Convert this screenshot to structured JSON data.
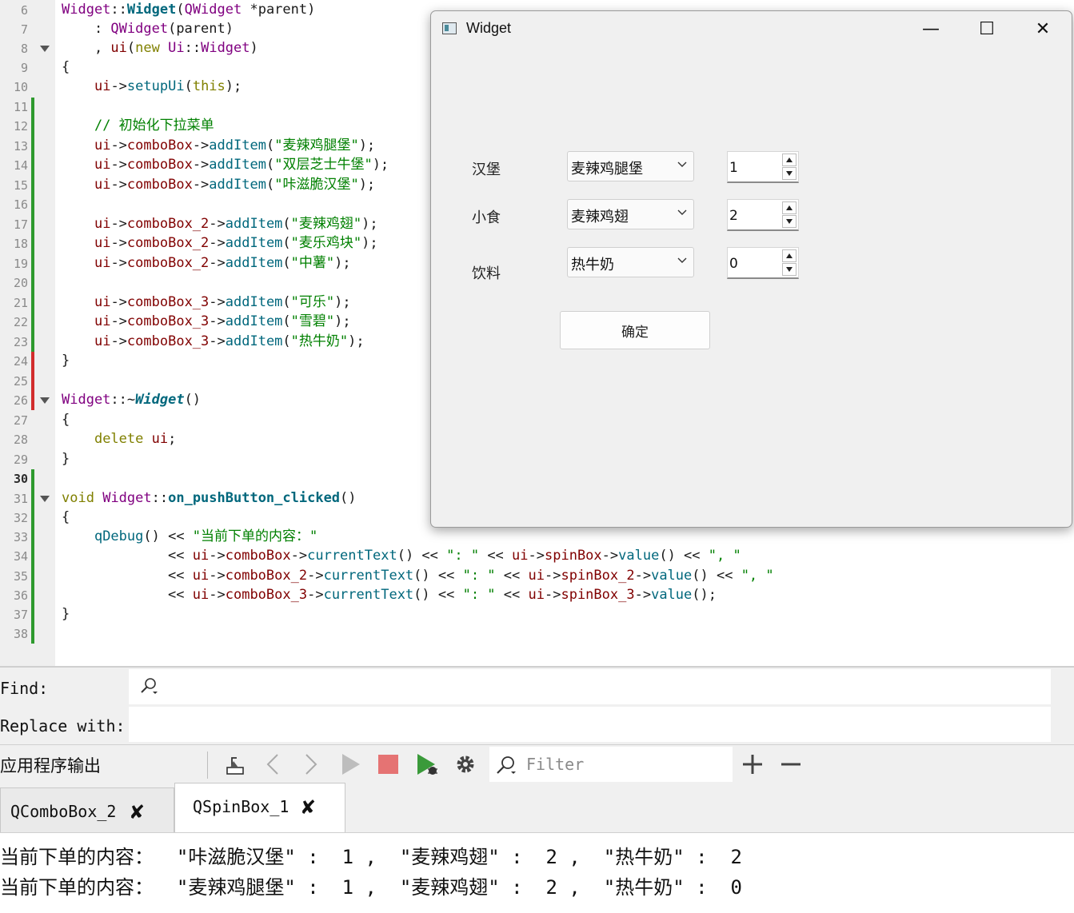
{
  "editor": {
    "line_numbers": [
      "6",
      "7",
      "8",
      "9",
      "10",
      "11",
      "12",
      "13",
      "14",
      "15",
      "16",
      "17",
      "18",
      "19",
      "20",
      "21",
      "22",
      "23",
      "24",
      "25",
      "26",
      "27",
      "28",
      "29",
      "30",
      "31",
      "32",
      "33",
      "34",
      "35",
      "36",
      "37",
      "38"
    ],
    "lines": [
      "Widget::Widget(QWidget *parent)",
      "    : QWidget(parent)",
      "    , ui(new Ui::Widget)",
      "{",
      "    ui->setupUi(this);",
      "",
      "    // 初始化下拉菜单",
      "    ui->comboBox->addItem(\"麦辣鸡腿堡\");",
      "    ui->comboBox->addItem(\"双层芝士牛堡\");",
      "    ui->comboBox->addItem(\"咔滋脆汉堡\");",
      "",
      "    ui->comboBox_2->addItem(\"麦辣鸡翅\");",
      "    ui->comboBox_2->addItem(\"麦乐鸡块\");",
      "    ui->comboBox_2->addItem(\"中薯\");",
      "",
      "    ui->comboBox_3->addItem(\"可乐\");",
      "    ui->comboBox_3->addItem(\"雪碧\");",
      "    ui->comboBox_3->addItem(\"热牛奶\");",
      "}",
      "",
      "Widget::~Widget()",
      "{",
      "    delete ui;",
      "}",
      "",
      "void Widget::on_pushButton_clicked()",
      "{",
      "    qDebug() << \"当前下单的内容：\"",
      "             << ui->comboBox->currentText() << \": \" << ui->spinBox->value() << \", \"",
      "             << ui->comboBox_2->currentText() << \": \" << ui->spinBox_2->value() << \", \"",
      "             << ui->comboBox_3->currentText() << \": \" << ui->spinBox_3->value();",
      "}",
      ""
    ]
  },
  "window": {
    "title": "Widget",
    "minimize": "—",
    "maximize": "☐",
    "close": "✕",
    "rows": [
      {
        "label": "汉堡",
        "combo": "麦辣鸡腿堡",
        "spin": "1"
      },
      {
        "label": "小食",
        "combo": "麦辣鸡翅",
        "spin": "2"
      },
      {
        "label": "饮料",
        "combo": "热牛奶",
        "spin": "0"
      }
    ],
    "ok_button": "确定"
  },
  "find": {
    "find_label": "Find:",
    "replace_label": "Replace with:"
  },
  "output": {
    "title": "应用程序输出",
    "filter_placeholder": "Filter",
    "tabs": [
      {
        "label": "QComboBox_2",
        "close": "✘"
      },
      {
        "label": "QSpinBox_1",
        "close": "✘"
      }
    ],
    "lines": [
      "当前下单的内容：  \"咔滋脆汉堡\" :  1 ,  \"麦辣鸡翅\" :  2 ,  \"热牛奶\" :  2",
      "当前下单的内容：  \"麦辣鸡腿堡\" :  1 ,  \"麦辣鸡翅\" :  2 ,  \"热牛奶\" :  0"
    ]
  }
}
